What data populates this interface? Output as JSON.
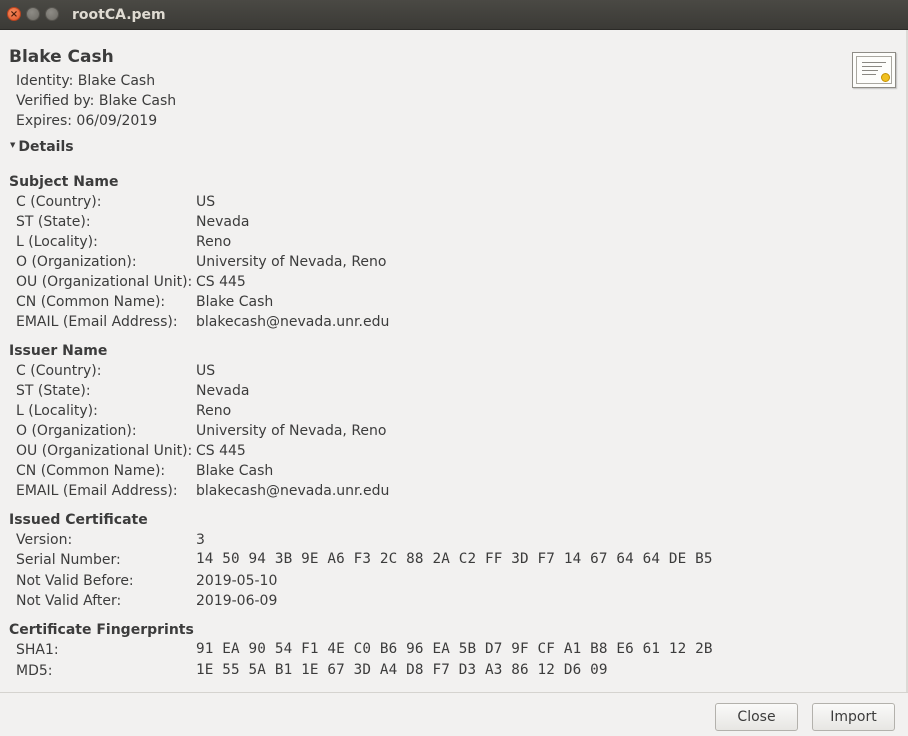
{
  "window": {
    "title": "rootCA.pem"
  },
  "summary": {
    "name": "Blake Cash",
    "identity": "Identity: Blake Cash",
    "verified_by": "Verified by: Blake Cash",
    "expires": "Expires: 06/09/2019"
  },
  "details": {
    "label": "Details",
    "expanded": true
  },
  "subject": {
    "heading": "Subject Name",
    "rows": [
      {
        "label": "C (Country):",
        "value": "US"
      },
      {
        "label": "ST (State):",
        "value": "Nevada"
      },
      {
        "label": "L (Locality):",
        "value": "Reno"
      },
      {
        "label": "O (Organization):",
        "value": "University of Nevada, Reno"
      },
      {
        "label": "OU (Organizational Unit):",
        "value": "CS 445"
      },
      {
        "label": "CN (Common Name):",
        "value": "Blake Cash"
      },
      {
        "label": "EMAIL (Email Address):",
        "value": "blakecash@nevada.unr.edu"
      }
    ]
  },
  "issuer": {
    "heading": "Issuer Name",
    "rows": [
      {
        "label": "C (Country):",
        "value": "US"
      },
      {
        "label": "ST (State):",
        "value": "Nevada"
      },
      {
        "label": "L (Locality):",
        "value": "Reno"
      },
      {
        "label": "O (Organization):",
        "value": "University of Nevada, Reno"
      },
      {
        "label": "OU (Organizational Unit):",
        "value": "CS 445"
      },
      {
        "label": "CN (Common Name):",
        "value": "Blake Cash"
      },
      {
        "label": "EMAIL (Email Address):",
        "value": "blakecash@nevada.unr.edu"
      }
    ]
  },
  "issued": {
    "heading": "Issued Certificate",
    "rows": [
      {
        "label": "Version:",
        "value": "3"
      },
      {
        "label": "Serial Number:",
        "value": "14 50 94 3B 9E A6 F3 2C 88 2A C2 FF 3D F7 14 67 64 64 DE B5"
      },
      {
        "label": "Not Valid Before:",
        "value": "2019-05-10"
      },
      {
        "label": "Not Valid After:",
        "value": "2019-06-09"
      }
    ]
  },
  "fingerprints": {
    "heading": "Certificate Fingerprints",
    "rows": [
      {
        "label": "SHA1:",
        "value": "91 EA 90 54 F1 4E C0 B6 96 EA 5B D7 9F CF A1 B8 E6 61 12 2B"
      },
      {
        "label": "MD5:",
        "value": "1E 55 5A B1 1E 67 3D A4 D8 F7 D3 A3 86 12 D6 09"
      }
    ]
  },
  "buttons": {
    "close": "Close",
    "import": "Import"
  },
  "icons": {
    "window_close": "close-icon",
    "window_minimize": "minimize-icon",
    "window_maximize": "maximize-icon",
    "certificate": "certificate-icon",
    "expander": "triangle-down-icon"
  }
}
